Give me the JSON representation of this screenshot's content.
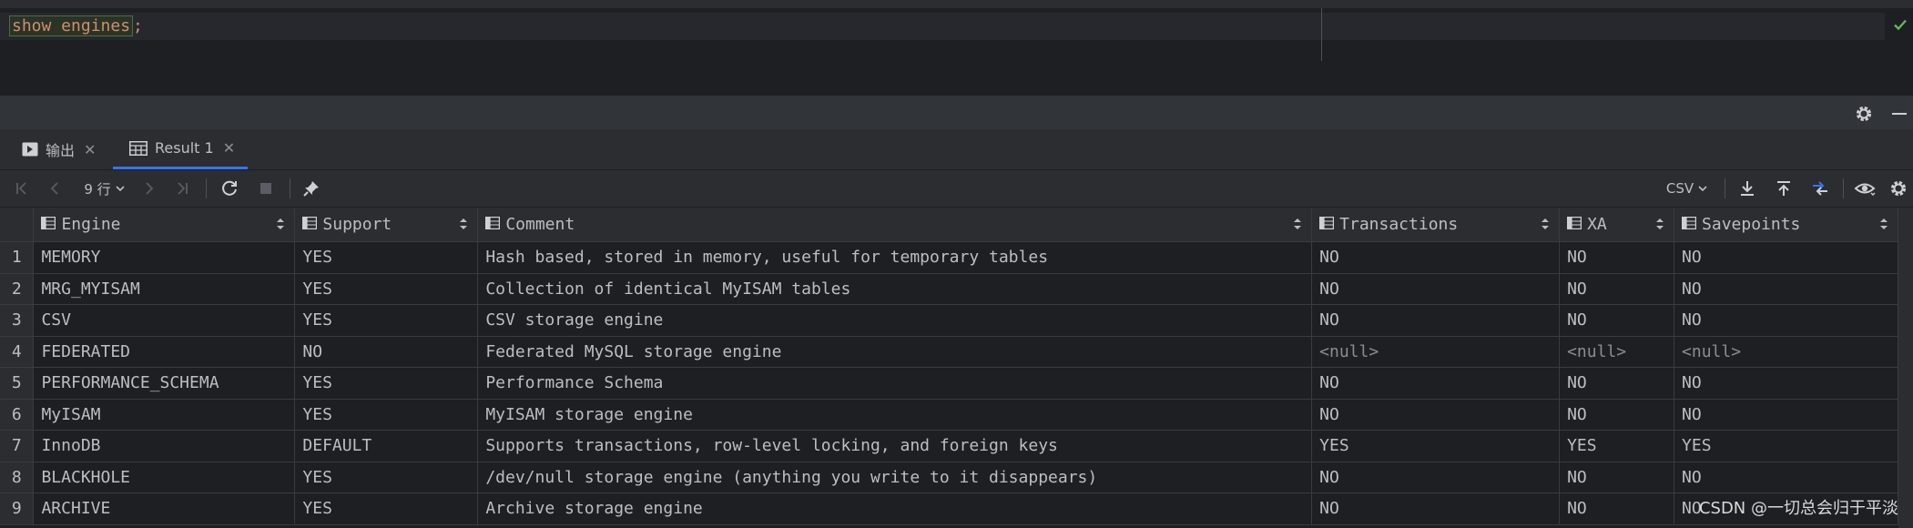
{
  "editor": {
    "code_keyword": "show engines",
    "code_semicolon": ";"
  },
  "tabs": [
    {
      "label": "输出",
      "icon": "console-icon"
    },
    {
      "label": "Result 1",
      "icon": "table-icon"
    }
  ],
  "toolbar": {
    "rows_label": "9 行",
    "export_format": "CSV"
  },
  "grid": {
    "columns": [
      "Engine",
      "Support",
      "Comment",
      "Transactions",
      "XA",
      "Savepoints"
    ],
    "rows": [
      {
        "num": "1",
        "cells": [
          "MEMORY",
          "YES",
          "Hash based, stored in memory, useful for temporary tables",
          "NO",
          "NO",
          "NO"
        ]
      },
      {
        "num": "2",
        "cells": [
          "MRG_MYISAM",
          "YES",
          "Collection of identical MyISAM tables",
          "NO",
          "NO",
          "NO"
        ]
      },
      {
        "num": "3",
        "cells": [
          "CSV",
          "YES",
          "CSV storage engine",
          "NO",
          "NO",
          "NO"
        ]
      },
      {
        "num": "4",
        "cells": [
          "FEDERATED",
          "NO",
          "Federated MySQL storage engine",
          "<null>",
          "<null>",
          "<null>"
        ]
      },
      {
        "num": "5",
        "cells": [
          "PERFORMANCE_SCHEMA",
          "YES",
          "Performance Schema",
          "NO",
          "NO",
          "NO"
        ]
      },
      {
        "num": "6",
        "cells": [
          "MyISAM",
          "YES",
          "MyISAM storage engine",
          "NO",
          "NO",
          "NO"
        ]
      },
      {
        "num": "7",
        "cells": [
          "InnoDB",
          "DEFAULT",
          "Supports transactions, row-level locking, and foreign keys",
          "YES",
          "YES",
          "YES"
        ]
      },
      {
        "num": "8",
        "cells": [
          "BLACKHOLE",
          "YES",
          "/dev/null storage engine (anything you write to it disappears)",
          "NO",
          "NO",
          "NO"
        ]
      },
      {
        "num": "9",
        "cells": [
          "ARCHIVE",
          "YES",
          "Archive storage engine",
          "NO",
          "NO",
          "NO"
        ]
      }
    ]
  },
  "watermark": "CSDN @一切总会归于平淡",
  "colors": {
    "accent": "#3574f0",
    "keyword": "#cf8e6d",
    "success": "#5fb85a"
  }
}
